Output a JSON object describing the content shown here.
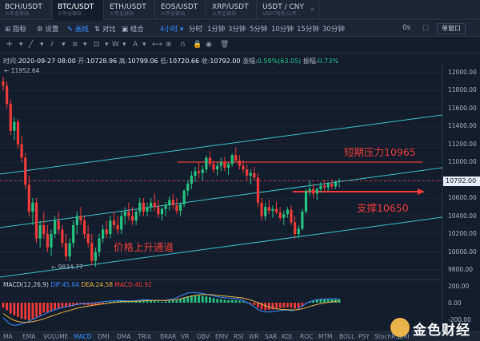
{
  "tabs": [
    {
      "pair": "BCH/USDT",
      "sub": "火币全球站",
      "left": 0,
      "width": 65,
      "active": false
    },
    {
      "pair": "BTC/USDT",
      "sub": "火币全球站",
      "left": 66,
      "width": 64,
      "active": true
    },
    {
      "pair": "ETH/USDT",
      "sub": "火币全球站",
      "left": 131,
      "width": 63,
      "active": false
    },
    {
      "pair": "EOS/USDT",
      "sub": "火币全球站",
      "left": 195,
      "width": 63,
      "active": false
    },
    {
      "pair": "XRP/USDT",
      "sub": "火币全球站",
      "left": 259,
      "width": 62,
      "active": false
    },
    {
      "pair": "USDT / CNY",
      "sub": "USDT场外/火币…",
      "left": 322,
      "width": 77,
      "active": false
    }
  ],
  "tab_close": "×",
  "toolbar": {
    "indicators": "指标",
    "settings": "设置",
    "draw": "画线",
    "compare": "对比",
    "combine": "组合",
    "interval": "4小时",
    "timeline": "分时",
    "m1": "1分钟",
    "m3": "3分钟",
    "m5": "5分钟",
    "m10": "10分钟",
    "m15": "15分钟",
    "m30": "30分钟",
    "zero": "0s",
    "window": "单窗口"
  },
  "info": {
    "time_label": "时间:",
    "time": "2020-09-27 08:00",
    "open_label": "开:",
    "open": "10728.96",
    "high_label": "高:",
    "high": "10799.06",
    "low_label": "低:",
    "low": "10720.66",
    "close_label": "收:",
    "close": "10792.00",
    "change_label": "涨幅:",
    "change": "0.59%(63.05)",
    "amp_label": "振幅:",
    "amp": "0.73%"
  },
  "annotations": {
    "resistance": "短期压力10965",
    "support": "支撑10650",
    "channel": "价格上升通道"
  },
  "price_tag": "10792.00",
  "markers": {
    "high": "11952.64",
    "low": "9834.77"
  },
  "macd": {
    "label": "MACD(12,26,9)",
    "dif_label": "DIF:",
    "dif": "45.04",
    "dea_label": "DEA:",
    "dea": "24.58",
    "macd_label": "MACD:",
    "macd": "40.92",
    "ticks": [
      "200.00",
      "0.00",
      "-200.00"
    ]
  },
  "y_axis": [
    "12000.00",
    "11800.00",
    "11600.00",
    "11400.00",
    "11200.00",
    "11000.00",
    "10800.00",
    "10600.00",
    "10400.00",
    "10200.00",
    "10000.00",
    "9800.00"
  ],
  "indicators_bar": [
    "MA",
    "EMA",
    "VOLUME",
    "MACD",
    "DMI",
    "DMA",
    "TRIX",
    "BRAR",
    "VR",
    "OBV",
    "EMV",
    "RSI",
    "WR",
    "SAR",
    "KDJ",
    "ROC",
    "MTM",
    "BOLL",
    "PSY",
    "StochRSI",
    "SMI"
  ],
  "indicators_bar_active": "MACD",
  "watermark": "金色财经",
  "colors": {
    "up": "#26c281",
    "down": "#ef3b3b",
    "channel": "#3fc1d0",
    "accent": "#3a8dff"
  },
  "chart_data": {
    "type": "candlestick",
    "ylim": [
      9800,
      12060
    ],
    "candles": [
      [
        11900,
        11952,
        11800,
        11850
      ],
      [
        11850,
        11900,
        11600,
        11650
      ],
      [
        11650,
        11700,
        11300,
        11350
      ],
      [
        11350,
        11500,
        11250,
        11450
      ],
      [
        11450,
        11480,
        11150,
        11200
      ],
      [
        11200,
        11300,
        11000,
        11050
      ],
      [
        11050,
        11100,
        10700,
        10750
      ],
      [
        10750,
        10850,
        10400,
        10450
      ],
      [
        10450,
        10600,
        10300,
        10550
      ],
      [
        10550,
        10600,
        10100,
        10150
      ],
      [
        10150,
        10350,
        10050,
        10300
      ],
      [
        10300,
        10450,
        10150,
        10200
      ],
      [
        10200,
        10300,
        10000,
        10050
      ],
      [
        10050,
        10250,
        9950,
        10200
      ],
      [
        10200,
        10400,
        10150,
        10350
      ],
      [
        10350,
        10450,
        10200,
        10250
      ],
      [
        10250,
        10300,
        10050,
        10100
      ],
      [
        10100,
        10200,
        9900,
        9950
      ],
      [
        9950,
        10150,
        9900,
        10100
      ],
      [
        10100,
        10350,
        10050,
        10300
      ],
      [
        10300,
        10450,
        10200,
        10400
      ],
      [
        10400,
        10500,
        10300,
        10350
      ],
      [
        10350,
        10400,
        10150,
        10200
      ],
      [
        10200,
        10300,
        10050,
        10100
      ],
      [
        10100,
        10200,
        9850,
        9900
      ],
      [
        9900,
        10050,
        9834,
        10000
      ],
      [
        10000,
        10200,
        9950,
        10150
      ],
      [
        10150,
        10300,
        10100,
        10250
      ],
      [
        10250,
        10350,
        10150,
        10200
      ],
      [
        10200,
        10400,
        10150,
        10350
      ],
      [
        10350,
        10450,
        10250,
        10300
      ],
      [
        10300,
        10400,
        10200,
        10250
      ],
      [
        10250,
        10450,
        10200,
        10400
      ],
      [
        10400,
        10500,
        10300,
        10450
      ],
      [
        10450,
        10550,
        10350,
        10400
      ],
      [
        10400,
        10500,
        10300,
        10350
      ],
      [
        10350,
        10480,
        10300,
        10450
      ],
      [
        10450,
        10600,
        10400,
        10550
      ],
      [
        10550,
        10600,
        10400,
        10450
      ],
      [
        10450,
        10550,
        10400,
        10500
      ],
      [
        10500,
        10600,
        10450,
        10550
      ],
      [
        10550,
        10650,
        10450,
        10500
      ],
      [
        10500,
        10580,
        10380,
        10420
      ],
      [
        10420,
        10500,
        10350,
        10480
      ],
      [
        10480,
        10560,
        10400,
        10520
      ],
      [
        10520,
        10620,
        10460,
        10580
      ],
      [
        10580,
        10650,
        10480,
        10520
      ],
      [
        10520,
        10600,
        10420,
        10460
      ],
      [
        10460,
        10550,
        10400,
        10530
      ],
      [
        10530,
        10700,
        10500,
        10680
      ],
      [
        10680,
        10800,
        10620,
        10760
      ],
      [
        10760,
        10900,
        10700,
        10850
      ],
      [
        10850,
        10950,
        10780,
        10900
      ],
      [
        10900,
        11000,
        10820,
        10880
      ],
      [
        10880,
        10960,
        10800,
        10920
      ],
      [
        10920,
        11080,
        10880,
        11050
      ],
      [
        11050,
        11120,
        10950,
        10980
      ],
      [
        10980,
        11020,
        10880,
        10920
      ],
      [
        10920,
        11000,
        10850,
        10960
      ],
      [
        10960,
        11050,
        10900,
        11000
      ],
      [
        11000,
        11060,
        10900,
        10940
      ],
      [
        10940,
        11000,
        10860,
        10980
      ],
      [
        10980,
        11100,
        10950,
        11080
      ],
      [
        11080,
        11170,
        11000,
        11020
      ],
      [
        11020,
        11080,
        10920,
        10960
      ],
      [
        10960,
        11020,
        10880,
        10920
      ],
      [
        10920,
        10980,
        10800,
        10850
      ],
      [
        10850,
        10920,
        10750,
        10880
      ],
      [
        10880,
        10950,
        10800,
        10830
      ],
      [
        10830,
        10880,
        10500,
        10550
      ],
      [
        10550,
        10600,
        10350,
        10400
      ],
      [
        10400,
        10550,
        10350,
        10500
      ],
      [
        10500,
        10580,
        10420,
        10460
      ],
      [
        10460,
        10520,
        10380,
        10480
      ],
      [
        10480,
        10560,
        10420,
        10440
      ],
      [
        10440,
        10500,
        10350,
        10380
      ],
      [
        10380,
        10460,
        10300,
        10420
      ],
      [
        10420,
        10500,
        10380,
        10470
      ],
      [
        10470,
        10520,
        10300,
        10330
      ],
      [
        10330,
        10400,
        10150,
        10200
      ],
      [
        10200,
        10300,
        10150,
        10260
      ],
      [
        10260,
        10480,
        10240,
        10450
      ],
      [
        10450,
        10700,
        10420,
        10680
      ],
      [
        10680,
        10800,
        10620,
        10700
      ],
      [
        10700,
        10760,
        10600,
        10650
      ],
      [
        10650,
        10720,
        10580,
        10700
      ],
      [
        10700,
        10780,
        10660,
        10740
      ],
      [
        10740,
        10800,
        10680,
        10720
      ],
      [
        10720,
        10780,
        10680,
        10760
      ],
      [
        10760,
        10810,
        10700,
        10730
      ],
      [
        10730,
        10800,
        10700,
        10780
      ],
      [
        10780,
        10820,
        10720,
        10792
      ]
    ],
    "macd_hist": [
      -60,
      -90,
      -130,
      -150,
      -170,
      -190,
      -200,
      -210,
      -190,
      -170,
      -150,
      -120,
      -110,
      -100,
      -80,
      -70,
      -60,
      -55,
      -50,
      -40,
      -30,
      -20,
      -25,
      -30,
      -40,
      -35,
      -20,
      -10,
      0,
      10,
      15,
      20,
      25,
      20,
      15,
      10,
      15,
      20,
      25,
      30,
      25,
      20,
      15,
      10,
      15,
      20,
      25,
      30,
      45,
      60,
      75,
      85,
      90,
      85,
      80,
      75,
      65,
      55,
      45,
      40,
      35,
      30,
      35,
      30,
      25,
      15,
      0,
      -15,
      -30,
      -60,
      -80,
      -90,
      -85,
      -80,
      -70,
      -65,
      -60,
      -55,
      -60,
      -70,
      -60,
      -40,
      -10,
      15,
      30,
      40,
      45,
      45,
      42,
      40,
      40,
      41
    ],
    "macd_dif": [
      -180,
      -220,
      -260,
      -270,
      -265,
      -255,
      -240,
      -220,
      -200,
      -180,
      -160,
      -140,
      -120,
      -100,
      -85,
      -70,
      -60,
      -50,
      -40,
      -30,
      -20,
      -15,
      -10,
      -10,
      -5,
      0,
      5,
      10,
      15,
      20,
      20,
      25,
      25,
      20,
      20,
      20,
      25,
      30,
      35,
      35,
      30,
      30,
      25,
      25,
      30,
      35,
      45,
      60,
      80,
      100,
      115,
      120,
      120,
      115,
      110,
      100,
      90,
      80,
      70,
      65,
      60,
      55,
      55,
      50,
      40,
      25,
      5,
      -20,
      -50,
      -80,
      -100,
      -110,
      -110,
      -105,
      -100,
      -95,
      -90,
      -90,
      -95,
      -90,
      -70,
      -40,
      -10,
      10,
      25,
      35,
      40,
      42,
      44,
      45,
      45,
      45
    ],
    "macd_dea": [
      -130,
      -160,
      -190,
      -210,
      -225,
      -232,
      -235,
      -232,
      -226,
      -217,
      -206,
      -193,
      -178,
      -162,
      -146,
      -131,
      -117,
      -104,
      -91,
      -79,
      -67,
      -57,
      -48,
      -40,
      -33,
      -27,
      -21,
      -15,
      -9,
      -3,
      2,
      7,
      11,
      13,
      14,
      15,
      17,
      19,
      22,
      25,
      27,
      28,
      28,
      27,
      27,
      29,
      32,
      38,
      46,
      57,
      69,
      79,
      87,
      93,
      96,
      97,
      96,
      93,
      88,
      84,
      79,
      74,
      70,
      66,
      61,
      54,
      44,
      32,
      16,
      -1,
      -19,
      -37,
      -52,
      -64,
      -73,
      -79,
      -82,
      -84,
      -86,
      -87,
      -82,
      -73,
      -60,
      -46,
      -33,
      -21,
      -11,
      -3,
      4,
      10,
      15,
      19
    ]
  }
}
